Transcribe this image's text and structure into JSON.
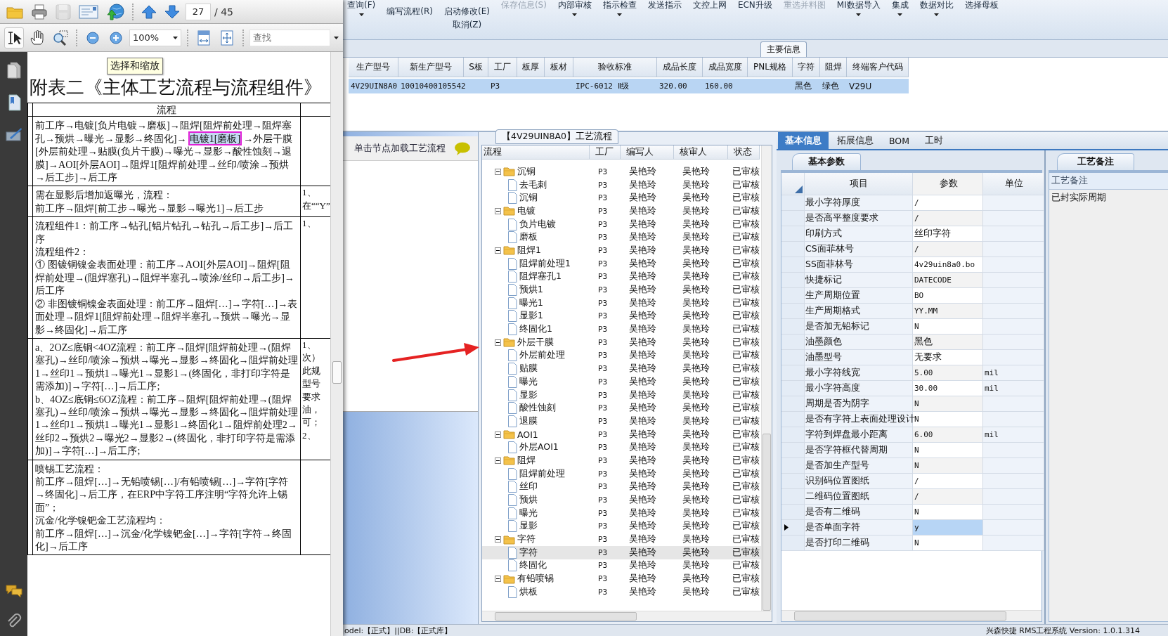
{
  "pdf_viewer": {
    "file_buttons": [
      {
        "kind": "open",
        "disabled": false
      },
      {
        "kind": "print",
        "disabled": false
      },
      {
        "kind": "save",
        "disabled": true
      },
      {
        "kind": "email",
        "disabled": false
      },
      {
        "kind": "upload",
        "disabled": false
      }
    ],
    "nav_buttons": [
      {
        "kind": "up"
      },
      {
        "kind": "down"
      }
    ],
    "page": "27",
    "page_count": "/ 45",
    "tools": [
      {
        "kind": "select",
        "selected": true
      },
      {
        "kind": "hand",
        "selected": false
      },
      {
        "kind": "marquee",
        "selected": false
      }
    ],
    "zoom_buttons": [
      {
        "kind": "zoom_out"
      },
      {
        "kind": "zoom_in"
      }
    ],
    "zoom": "100%",
    "view_buttons": [
      {
        "kind": "fit_width"
      },
      {
        "kind": "fit_page"
      }
    ],
    "search_placeholder": "查找",
    "side_panels": [
      {
        "kind": "pages"
      },
      {
        "kind": "bookmarks"
      },
      {
        "kind": "signatures"
      }
    ],
    "bottom_panels": [
      {
        "kind": "comments"
      },
      {
        "kind": "attachments"
      }
    ],
    "tooltip": "选择和缩放",
    "document": {
      "title": "附表二《主体工艺流程与流程组件》",
      "header": "流程",
      "rows": [
        {
          "parts": [
            {
              "text": "前工序→电镀[负片电镀→磨板]→阻焊[阻焊前处理→阻焊塞孔→预烘→曝光→显影→终固化]→",
              "highlighted": false
            },
            {
              "text": "电镀1[磨板]",
              "highlighted": true
            },
            {
              "text": "→外层干膜[外层前处理→贴膜(负片干膜)→曝光→显影→酸性蚀刻→退膜]→AOI[外层AOI]→阻焊1[阻焊前处理→丝印/喷涂→预烘→后工步]→后工序",
              "highlighted": false
            }
          ]
        },
        {
          "parts": [
            {
              "text": "需在显影后增加返曝光，流程：",
              "highlighted": false
            }
          ],
          "line_2": "前工序→阻焊[前工步→曝光→显影→曝光1]→后工步",
          "note": "1、在““Y”"
        },
        {
          "parts": [
            {
              "text": "流程组件1：前工序→钻孔[铝片钻孔→钻孔→后工步]→后工序",
              "highlighted": false
            }
          ],
          "line_2": "流程组件2：",
          "line_3": "① 图镀铜镍金表面处理：前工序→AOI[外层AOI]→阻焊[阻焊前处理→(阻焊塞孔)→阻焊半塞孔→喷涂/丝印→后工步]→后工序",
          "line_4": "② 非图镀铜镍金表面处理：前工序→阻焊[…]→字符[…]→表面处理→阻焊1[阻焊前处理→阻焊半塞孔→预烘→曝光→显影→终固化]→后工序",
          "note": "1、"
        },
        {
          "parts": [
            {
              "text": "a、2OZ≤底铜<4OZ流程：前工序→阻焊[阻焊前处理→(阻焊塞孔)→丝印/喷涂→预烘→曝光→显影→终固化→阻焊前处理1→丝印1→预烘1→曝光1→显影1→(终固化，非打印字符是需添加)]→字符[…]→后工序;",
              "highlighted": false
            }
          ],
          "line_2": "b、4OZ≤底铜≤6OZ流程：前工序→阻焊[阻焊前处理→(阻焊塞孔)→丝印/喷涂→预烘→曝光→显影→终固化→阻焊前处理1→丝印1→预烘1→曝光1→显影1→终固化1→阻焊前处理2→丝印2→预烘2→曝光2→显影2→(终固化，非打印字符是需添加)]→字符[…]→后工序;",
          "note": "1、次）此规型号要求油，可；2、"
        },
        {
          "parts": [
            {
              "text": "喷锡工艺流程：",
              "highlighted": false
            }
          ],
          "line_2": "前工序→阻焊[…]→无铅喷锡[…]/有铅喷锡[…]→字符[字符→终固化]→后工序，在ERP中字符工序注明“字符允许上锡面”；",
          "line_3": "沉金/化学镍钯金工艺流程均：",
          "line_4": "前工序→阻焊[…]→沉金/化学镍钯金[…]→字符[字符→终固化]→后工序"
        }
      ]
    }
  },
  "app": {
    "toolbar": [
      {
        "label": "查询(F)",
        "kind": "top",
        "disabled": false,
        "dropdown": true
      },
      {
        "label": "编写流程(R)",
        "kind": "lower",
        "disabled": false,
        "dropdown": false
      },
      {
        "label": "启动修改(E)",
        "kind": "lower",
        "disabled": false,
        "dropdown": false,
        "sub": "取消(Z)"
      },
      {
        "label": "保存信息(S)",
        "kind": "top",
        "disabled": true,
        "dropdown": false
      },
      {
        "label": "内部审核",
        "kind": "top",
        "disabled": false,
        "dropdown": true
      },
      {
        "label": "指示检查",
        "kind": "top",
        "disabled": false,
        "dropdown": true
      },
      {
        "label": "发送指示",
        "kind": "top",
        "disabled": false,
        "dropdown": false
      },
      {
        "label": "文控上网",
        "kind": "top",
        "disabled": false,
        "dropdown": false
      },
      {
        "label": "ECN升级",
        "kind": "top",
        "disabled": false,
        "dropdown": false
      },
      {
        "label": "重选并料图",
        "kind": "top",
        "disabled": true,
        "dropdown": false
      },
      {
        "label": "MI数据导入",
        "kind": "top",
        "disabled": false,
        "dropdown": true
      },
      {
        "label": "集成",
        "kind": "top",
        "disabled": false,
        "dropdown": true
      },
      {
        "label": "数据对比",
        "kind": "top",
        "disabled": false,
        "dropdown": true
      },
      {
        "label": "选择母板",
        "kind": "top",
        "disabled": false,
        "dropdown": false
      }
    ],
    "main_info": {
      "title": "主要信息",
      "row_selected": true,
      "columns": [
        {
          "label": "生产型号",
          "value": "4V29UIN8A0"
        },
        {
          "label": "新生产型号",
          "value": "10010400105542"
        },
        {
          "label": "S板"
        },
        {
          "label": "工厂",
          "value": "P3"
        },
        {
          "label": "板厚"
        },
        {
          "label": "板材"
        },
        {
          "label": "验收标准",
          "value": "IPC-6012 Ⅱ级"
        },
        {
          "label": "成品长度",
          "value": "320.00"
        },
        {
          "label": "成品宽度",
          "value": "160.00"
        },
        {
          "label": "PNL规格"
        },
        {
          "label": "字符",
          "value": "黑色"
        },
        {
          "label": "阻焊",
          "value": "绿色"
        },
        {
          "label": "终端客户代码",
          "value": "V29U"
        }
      ]
    },
    "load_hint": "单击节点加载工艺流程",
    "process": {
      "title": "【4V29UIN8A0】工艺流程",
      "columns": [
        "流程",
        "工厂",
        "编写人",
        "核审人",
        "状态"
      ],
      "nodes": [
        {
          "name": "沉铜",
          "factory": "P3",
          "writer": "吴艳玲",
          "reviewer": "吴艳玲",
          "status": "已审核",
          "expanded": true,
          "selected": false,
          "children": [
            {
              "name": "去毛刺",
              "factory": "P3",
              "writer": "吴艳玲",
              "reviewer": "吴艳玲",
              "status": "已审核",
              "selected": false
            },
            {
              "name": "沉铜",
              "factory": "P3",
              "writer": "吴艳玲",
              "reviewer": "吴艳玲",
              "status": "已审核",
              "selected": false
            }
          ]
        },
        {
          "name": "电镀",
          "factory": "P3",
          "writer": "吴艳玲",
          "reviewer": "吴艳玲",
          "status": "已审核",
          "expanded": true,
          "selected": false,
          "children": [
            {
              "name": "负片电镀",
              "factory": "P3",
              "writer": "吴艳玲",
              "reviewer": "吴艳玲",
              "status": "已审核",
              "selected": false
            },
            {
              "name": "磨板",
              "factory": "P3",
              "writer": "吴艳玲",
              "reviewer": "吴艳玲",
              "status": "已审核",
              "selected": false
            }
          ]
        },
        {
          "name": "阻焊1",
          "factory": "P3",
          "writer": "吴艳玲",
          "reviewer": "吴艳玲",
          "status": "已审核",
          "expanded": true,
          "selected": false,
          "children": [
            {
              "name": "阻焊前处理1",
              "factory": "P3",
              "writer": "吴艳玲",
              "reviewer": "吴艳玲",
              "status": "已审核",
              "selected": false
            },
            {
              "name": "阻焊塞孔1",
              "factory": "P3",
              "writer": "吴艳玲",
              "reviewer": "吴艳玲",
              "status": "已审核",
              "selected": false
            },
            {
              "name": "预烘1",
              "factory": "P3",
              "writer": "吴艳玲",
              "reviewer": "吴艳玲",
              "status": "已审核",
              "selected": false
            },
            {
              "name": "曝光1",
              "factory": "P3",
              "writer": "吴艳玲",
              "reviewer": "吴艳玲",
              "status": "已审核",
              "selected": false
            },
            {
              "name": "显影1",
              "factory": "P3",
              "writer": "吴艳玲",
              "reviewer": "吴艳玲",
              "status": "已审核",
              "selected": false
            },
            {
              "name": "终固化1",
              "factory": "P3",
              "writer": "吴艳玲",
              "reviewer": "吴艳玲",
              "status": "已审核",
              "selected": false
            }
          ]
        },
        {
          "name": "外层干膜",
          "factory": "P3",
          "writer": "吴艳玲",
          "reviewer": "吴艳玲",
          "status": "已审核",
          "expanded": true,
          "selected": false,
          "children": [
            {
              "name": "外层前处理",
              "factory": "P3",
              "writer": "吴艳玲",
              "reviewer": "吴艳玲",
              "status": "已审核",
              "selected": false
            },
            {
              "name": "贴膜",
              "factory": "P3",
              "writer": "吴艳玲",
              "reviewer": "吴艳玲",
              "status": "已审核",
              "selected": false
            },
            {
              "name": "曝光",
              "factory": "P3",
              "writer": "吴艳玲",
              "reviewer": "吴艳玲",
              "status": "已审核",
              "selected": false
            },
            {
              "name": "显影",
              "factory": "P3",
              "writer": "吴艳玲",
              "reviewer": "吴艳玲",
              "status": "已审核",
              "selected": false
            },
            {
              "name": "酸性蚀刻",
              "factory": "P3",
              "writer": "吴艳玲",
              "reviewer": "吴艳玲",
              "status": "已审核",
              "selected": false
            },
            {
              "name": "退膜",
              "factory": "P3",
              "writer": "吴艳玲",
              "reviewer": "吴艳玲",
              "status": "已审核",
              "selected": false
            }
          ]
        },
        {
          "name": "AOI1",
          "factory": "P3",
          "writer": "吴艳玲",
          "reviewer": "吴艳玲",
          "status": "已审核",
          "expanded": true,
          "selected": false,
          "children": [
            {
              "name": "外层AOI1",
              "factory": "P3",
              "writer": "吴艳玲",
              "reviewer": "吴艳玲",
              "status": "已审核",
              "selected": false
            }
          ]
        },
        {
          "name": "阻焊",
          "factory": "P3",
          "writer": "吴艳玲",
          "reviewer": "吴艳玲",
          "status": "已审核",
          "expanded": true,
          "selected": false,
          "children": [
            {
              "name": "阻焊前处理",
              "factory": "P3",
              "writer": "吴艳玲",
              "reviewer": "吴艳玲",
              "status": "已审核",
              "selected": false
            },
            {
              "name": "丝印",
              "factory": "P3",
              "writer": "吴艳玲",
              "reviewer": "吴艳玲",
              "status": "已审核",
              "selected": false
            },
            {
              "name": "预烘",
              "factory": "P3",
              "writer": "吴艳玲",
              "reviewer": "吴艳玲",
              "status": "已审核",
              "selected": false
            },
            {
              "name": "曝光",
              "factory": "P3",
              "writer": "吴艳玲",
              "reviewer": "吴艳玲",
              "status": "已审核",
              "selected": false
            },
            {
              "name": "显影",
              "factory": "P3",
              "writer": "吴艳玲",
              "reviewer": "吴艳玲",
              "status": "已审核",
              "selected": false
            }
          ]
        },
        {
          "name": "字符",
          "factory": "P3",
          "writer": "吴艳玲",
          "reviewer": "吴艳玲",
          "status": "已审核",
          "expanded": true,
          "selected": false,
          "children": [
            {
              "name": "字符",
              "factory": "P3",
              "writer": "吴艳玲",
              "reviewer": "吴艳玲",
              "status": "已审核",
              "selected": true
            },
            {
              "name": "终固化",
              "factory": "P3",
              "writer": "吴艳玲",
              "reviewer": "吴艳玲",
              "status": "已审核",
              "selected": false
            }
          ]
        },
        {
          "name": "有铅喷锡",
          "factory": "P3",
          "writer": "吴艳玲",
          "reviewer": "吴艳玲",
          "status": "已审核",
          "expanded": true,
          "selected": false,
          "children": [
            {
              "name": "烘板",
              "factory": "P3",
              "writer": "吴艳玲",
              "reviewer": "吴艳玲",
              "status": "已审核",
              "selected": false
            }
          ]
        }
      ]
    },
    "details": {
      "tabs": [
        {
          "label": "基本信息",
          "selected": true
        },
        {
          "label": "拓展信息",
          "selected": false
        },
        {
          "label": "BOM",
          "selected": false
        },
        {
          "label": "工时",
          "selected": false
        }
      ],
      "subtab": "基本参数",
      "columns": [
        "项目",
        "参数",
        "单位"
      ],
      "rows": [
        {
          "item": "最小字符厚度",
          "value": "/",
          "selected": false
        },
        {
          "item": "是否高平整度要求",
          "value": "/",
          "selected": false
        },
        {
          "item": "印刷方式",
          "value": "丝印字符",
          "selected": false
        },
        {
          "item": "CS面菲林号",
          "value": "/",
          "selected": false
        },
        {
          "item": "SS面菲林号",
          "value": "4v29uin8a0.bo",
          "selected": false
        },
        {
          "item": "快捷标记",
          "value": "DATECODE",
          "selected": false
        },
        {
          "item": "生产周期位置",
          "value": "BO",
          "selected": false
        },
        {
          "item": "生产周期格式",
          "value": "YY.MM",
          "selected": false
        },
        {
          "item": "是否加无铅标记",
          "value": "N",
          "selected": false
        },
        {
          "item": "油墨颜色",
          "value": "黑色",
          "selected": false
        },
        {
          "item": "油墨型号",
          "value": "无要求",
          "selected": false
        },
        {
          "item": "最小字符线宽",
          "value": "5.00",
          "unit": "mil",
          "selected": false
        },
        {
          "item": "最小字符高度",
          "value": "30.00",
          "unit": "mil",
          "selected": false
        },
        {
          "item": "周期是否为阴字",
          "value": "N",
          "selected": false
        },
        {
          "item": "是否有字符上表面处理设计",
          "value": "N",
          "selected": false
        },
        {
          "item": "字符到焊盘最小距离",
          "value": "6.00",
          "unit": "mil",
          "selected": false
        },
        {
          "item": "是否字符框代替周期",
          "value": "N",
          "selected": false
        },
        {
          "item": "是否加生产型号",
          "value": "N",
          "selected": false
        },
        {
          "item": "识别码位置图纸",
          "value": "/",
          "selected": false
        },
        {
          "item": "二维码位置图纸",
          "value": "/",
          "selected": false
        },
        {
          "item": "是否有二维码",
          "value": "N",
          "selected": false
        },
        {
          "item": "是否单面字符",
          "value": "y",
          "selected": true
        },
        {
          "item": "是否打印二维码",
          "value": "N",
          "selected": false
        }
      ]
    },
    "notes": {
      "tab": "工艺备注",
      "header": "工艺备注",
      "text": "已封实际周期"
    },
    "status_bar": {
      "left": "odel:【正式】||DB:【正式库】",
      "right": "兴森快捷 RMS工程系统 Version: 1.0.1.314"
    }
  }
}
